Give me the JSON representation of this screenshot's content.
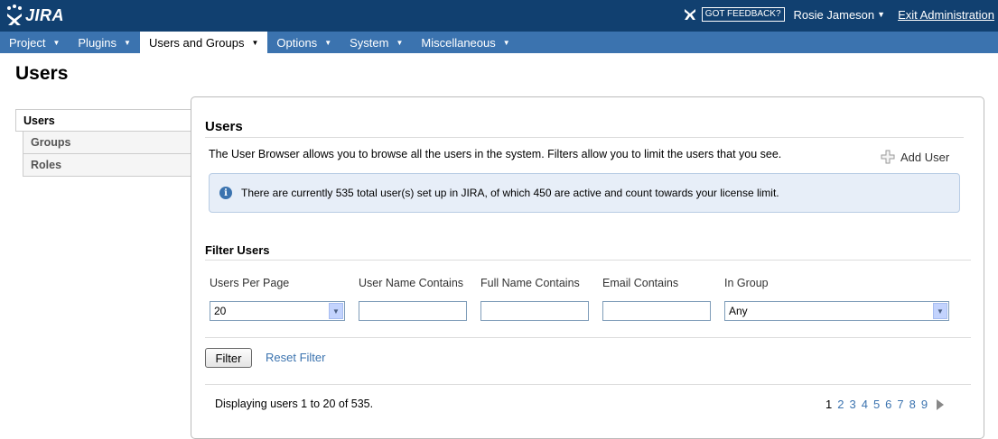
{
  "header": {
    "logo_text": "JIRA",
    "feedback_label": "GOT FEEDBACK?",
    "user_name": "Rosie Jameson",
    "exit_label": "Exit Administration"
  },
  "nav": {
    "items": [
      {
        "label": "Project"
      },
      {
        "label": "Plugins"
      },
      {
        "label": "Users and Groups",
        "active": true
      },
      {
        "label": "Options"
      },
      {
        "label": "System"
      },
      {
        "label": "Miscellaneous"
      }
    ]
  },
  "page_title": "Users",
  "sidebar": {
    "items": [
      {
        "label": "Users",
        "active": true
      },
      {
        "label": "Groups"
      },
      {
        "label": "Roles"
      }
    ]
  },
  "panel": {
    "title": "Users",
    "intro": "The User Browser allows you to browse all the users in the system. Filters allow you to limit the users that you see.",
    "add_user_label": "Add User",
    "info_text": "There are currently 535 total user(s) set up in JIRA, of which 450 are active and count towards your license limit."
  },
  "filter": {
    "title": "Filter Users",
    "labels": {
      "per_page": "Users Per Page",
      "username": "User Name Contains",
      "fullname": "Full Name Contains",
      "email": "Email Contains",
      "group": "In Group"
    },
    "values": {
      "per_page": "20",
      "username": "",
      "fullname": "",
      "email": "",
      "group": "Any"
    },
    "filter_button": "Filter",
    "reset_label": "Reset Filter"
  },
  "results": {
    "displaying": "Displaying users 1 to 20 of 535.",
    "pages": [
      "1",
      "2",
      "3",
      "4",
      "5",
      "6",
      "7",
      "8",
      "9"
    ],
    "current_page": "1"
  },
  "colors": {
    "header_bg": "#114070",
    "nav_bg": "#3b73af",
    "link": "#3b73af",
    "info_bg": "#e7eef8"
  }
}
